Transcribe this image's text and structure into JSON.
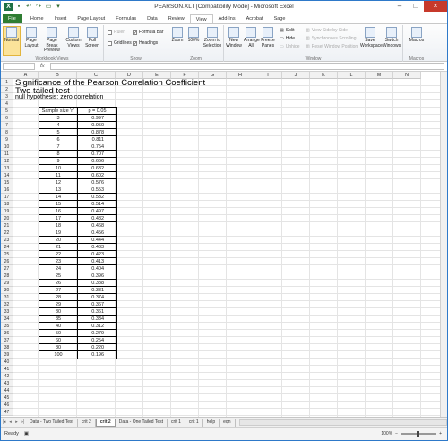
{
  "window": {
    "title": "PEARSON.XLT  [Compatibility Mode]  -  Microsoft Excel"
  },
  "ribbon_tabs": [
    "File",
    "Home",
    "Insert",
    "Page Layout",
    "Formulas",
    "Data",
    "Review",
    "View",
    "Add-Ins",
    "Acrobat",
    "Sage"
  ],
  "ribbon": {
    "workbook_views": {
      "label": "Workbook Views",
      "normal": "Normal",
      "page_layout": "Page Layout",
      "page_break": "Page Break Preview",
      "custom": "Custom Views",
      "full": "Full Screen"
    },
    "show": {
      "label": "Show",
      "ruler": "Ruler",
      "formula_bar": "Formula Bar",
      "gridlines": "Gridlines",
      "headings": "Headings"
    },
    "zoom": {
      "label": "Zoom",
      "zoom": "Zoom",
      "zoom100": "100%",
      "zoom_sel": "Zoom to Selection"
    },
    "window": {
      "label": "Window",
      "new": "New Window",
      "arrange": "Arrange All",
      "freeze": "Freeze Panes",
      "split": "Split",
      "hide": "Hide",
      "unhide": "Unhide",
      "side_by_side": "View Side by Side",
      "sync": "Synchronous Scrolling",
      "reset": "Reset Window Position",
      "save_ws": "Save Workspace",
      "switch": "Switch Windows"
    },
    "macros": {
      "label": "Macros",
      "macros": "Macros"
    }
  },
  "formula_bar": {
    "fx": "fx"
  },
  "columns": [
    "A",
    "B",
    "C",
    "D",
    "E",
    "F",
    "G",
    "H",
    "I",
    "J",
    "K",
    "L",
    "M",
    "N"
  ],
  "rows": [
    "1",
    "2",
    "3",
    "4",
    "5",
    "6",
    "7",
    "8",
    "9",
    "10",
    "11",
    "12",
    "13",
    "14",
    "15",
    "16",
    "17",
    "18",
    "19",
    "20",
    "21",
    "22",
    "23",
    "24",
    "25",
    "26",
    "27",
    "28",
    "29",
    "30",
    "31",
    "32",
    "33",
    "34",
    "35",
    "36",
    "37",
    "38",
    "39",
    "40",
    "41",
    "42",
    "43",
    "44",
    "45",
    "46",
    "47"
  ],
  "sheet": {
    "title": "Significance of the Pearson Correlation Coefficient",
    "subtitle": "Two tailed test",
    "hypothesis": "null hypothesis: zero correlation"
  },
  "table": {
    "headers": [
      "Sample size 'n'",
      "p = 0.05"
    ],
    "rows": [
      [
        "3",
        "0.997"
      ],
      [
        "4",
        "0.950"
      ],
      [
        "5",
        "0.878"
      ],
      [
        "6",
        "0.811"
      ],
      [
        "7",
        "0.754"
      ],
      [
        "8",
        "0.707"
      ],
      [
        "9",
        "0.666"
      ],
      [
        "10",
        "0.632"
      ],
      [
        "11",
        "0.602"
      ],
      [
        "12",
        "0.576"
      ],
      [
        "13",
        "0.553"
      ],
      [
        "14",
        "0.532"
      ],
      [
        "15",
        "0.514"
      ],
      [
        "16",
        "0.497"
      ],
      [
        "17",
        "0.482"
      ],
      [
        "18",
        "0.468"
      ],
      [
        "19",
        "0.456"
      ],
      [
        "20",
        "0.444"
      ],
      [
        "21",
        "0.433"
      ],
      [
        "22",
        "0.423"
      ],
      [
        "23",
        "0.413"
      ],
      [
        "24",
        "0.404"
      ],
      [
        "25",
        "0.396"
      ],
      [
        "26",
        "0.388"
      ],
      [
        "27",
        "0.381"
      ],
      [
        "28",
        "0.374"
      ],
      [
        "29",
        "0.367"
      ],
      [
        "30",
        "0.361"
      ],
      [
        "35",
        "0.334"
      ],
      [
        "40",
        "0.312"
      ],
      [
        "50",
        "0.279"
      ],
      [
        "60",
        "0.254"
      ],
      [
        "80",
        "0.220"
      ],
      [
        "100",
        "0.196"
      ]
    ]
  },
  "sheet_tabs": [
    "Data - Two Tailed Test",
    "crit 2",
    "Data - One Tailed Test",
    "crit 1",
    "help",
    "eqn"
  ],
  "active_sheet": "crit 2",
  "status": {
    "ready": "Ready",
    "zoom": "100%"
  }
}
